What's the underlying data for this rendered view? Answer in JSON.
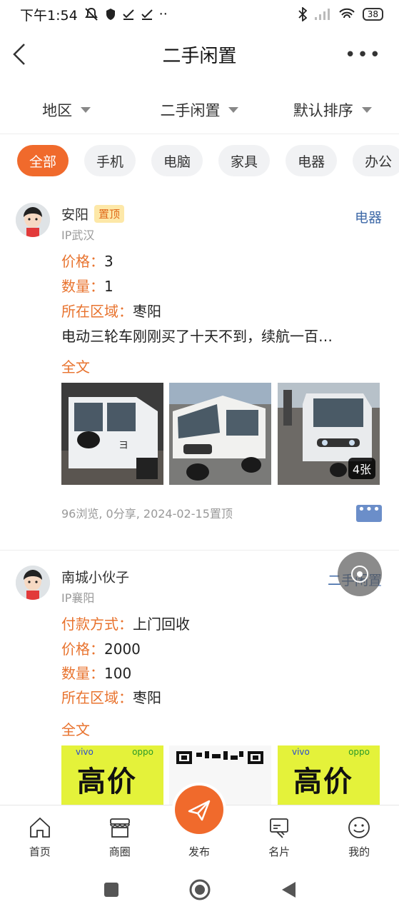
{
  "status_bar": {
    "time": "下午1:54",
    "battery": "38"
  },
  "header": {
    "title": "二手闲置",
    "back_icon": "chevron-left-icon",
    "more_icon": "more-icon"
  },
  "filters": [
    {
      "label": "地区"
    },
    {
      "label": "二手闲置"
    },
    {
      "label": "默认排序"
    }
  ],
  "chips": [
    {
      "label": "全部",
      "active": true
    },
    {
      "label": "手机"
    },
    {
      "label": "电脑"
    },
    {
      "label": "家具"
    },
    {
      "label": "电器"
    },
    {
      "label": "办公"
    }
  ],
  "posts": [
    {
      "user": "安阳",
      "pin_badge": "置顶",
      "ip": "IP武汉",
      "category": "电器",
      "fields": [
        {
          "key": "价格：",
          "value": "3"
        },
        {
          "key": "数量：",
          "value": "1"
        },
        {
          "key": "所在区域：",
          "value": "枣阳"
        }
      ],
      "description": "电动三轮车刚刚买了十天不到，续航一百…",
      "fulltext": "全文",
      "image_count": "4张",
      "meta": "96浏览, 0分享, 2024-02-15置顶"
    },
    {
      "user": "南城小伙子",
      "ip": "IP襄阳",
      "category": "二手闲置",
      "fields": [
        {
          "key": "付款方式：",
          "value": "上门回收"
        },
        {
          "key": "价格：",
          "value": "2000"
        },
        {
          "key": "数量：",
          "value": "100"
        },
        {
          "key": "所在区域：",
          "value": "枣阳"
        }
      ],
      "fulltext": "全文",
      "poster_text": "高价",
      "poster_brand_1": "vivo",
      "poster_brand_2": "oppo"
    }
  ],
  "tabbar": [
    {
      "label": "首页",
      "icon": "home-icon"
    },
    {
      "label": "商圈",
      "icon": "shop-icon"
    },
    {
      "label": "发布",
      "icon": "send-icon"
    },
    {
      "label": "名片",
      "icon": "card-icon"
    },
    {
      "label": "我的",
      "icon": "smile-icon"
    }
  ],
  "colors": {
    "accent": "#f06a2c",
    "link": "#3f6aa8",
    "key": "#e8732e"
  }
}
